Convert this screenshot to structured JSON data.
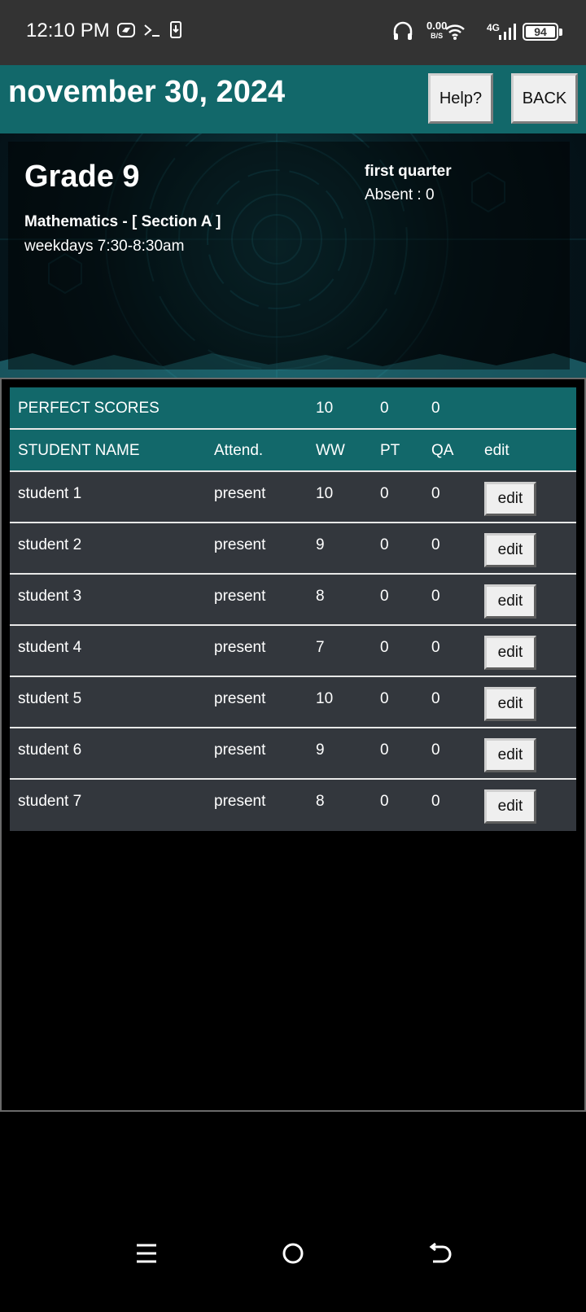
{
  "status_bar": {
    "time": "12:10 PM",
    "net_speed": "0.00",
    "net_unit": "B/S",
    "network": "4G",
    "battery": "94"
  },
  "header": {
    "date": "november 30, 2024",
    "help_label": "Help?",
    "back_label": "BACK"
  },
  "class_info": {
    "grade": "Grade 9",
    "subject": "Mathematics - [ Section A ]",
    "schedule": "weekdays 7:30-8:30am",
    "quarter": "first quarter",
    "absent": "Absent : 0"
  },
  "table": {
    "perfect_scores": {
      "label": "PERFECT SCORES",
      "ww": "10",
      "pt": "0",
      "qa": "0"
    },
    "headers": {
      "name": "STUDENT NAME",
      "attend": "Attend.",
      "ww": "WW",
      "pt": "PT",
      "qa": "QA",
      "edit": "edit"
    },
    "edit_label": "edit",
    "rows": [
      {
        "name": "student 1",
        "attend": "present",
        "ww": "10",
        "pt": "0",
        "qa": "0"
      },
      {
        "name": "student 2",
        "attend": "present",
        "ww": "9",
        "pt": "0",
        "qa": "0"
      },
      {
        "name": "student 3",
        "attend": "present",
        "ww": "8",
        "pt": "0",
        "qa": "0"
      },
      {
        "name": "student 4",
        "attend": "present",
        "ww": "7",
        "pt": "0",
        "qa": "0"
      },
      {
        "name": "student 5",
        "attend": "present",
        "ww": "10",
        "pt": "0",
        "qa": "0"
      },
      {
        "name": "student 6",
        "attend": "present",
        "ww": "9",
        "pt": "0",
        "qa": "0"
      },
      {
        "name": "student 7",
        "attend": "present",
        "ww": "8",
        "pt": "0",
        "qa": "0"
      }
    ]
  },
  "nav": {
    "icons": [
      "menu-icon",
      "home-icon",
      "back-icon"
    ]
  }
}
